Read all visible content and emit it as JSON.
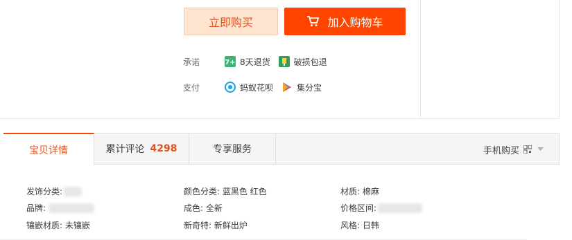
{
  "purchase": {
    "buy_now_label": "立即购买",
    "add_to_cart_label": "加入购物车"
  },
  "promise": {
    "label": "承诺",
    "items": [
      {
        "text": "8天退货",
        "icon": "return-8days-icon"
      },
      {
        "text": "破损包退",
        "icon": "damage-return-icon"
      }
    ]
  },
  "payment": {
    "label": "支付",
    "items": [
      {
        "text": "蚂蚁花呗",
        "icon": "huabei-icon"
      },
      {
        "text": "集分宝",
        "icon": "jifenbao-icon"
      }
    ]
  },
  "tabs": {
    "details": "宝贝详情",
    "reviews_label": "累计评论",
    "reviews_count": "4298",
    "service": "专享服务",
    "mobile_buy": "手机购买"
  },
  "attributes": {
    "col1": [
      "发饰分类:",
      "品牌:",
      "镶嵌材质: 未镶嵌"
    ],
    "col2": [
      "颜色分类: 蓝黑色 红色",
      "成色: 全新",
      "新奇特: 新鲜出炉"
    ],
    "col3": [
      "材质: 棉麻",
      "价格区间:",
      "风格: 日韩"
    ]
  },
  "colors": {
    "accent": "#ff4400",
    "accent_text": "#e5511d",
    "buy_bg": "#ffe4d0"
  }
}
